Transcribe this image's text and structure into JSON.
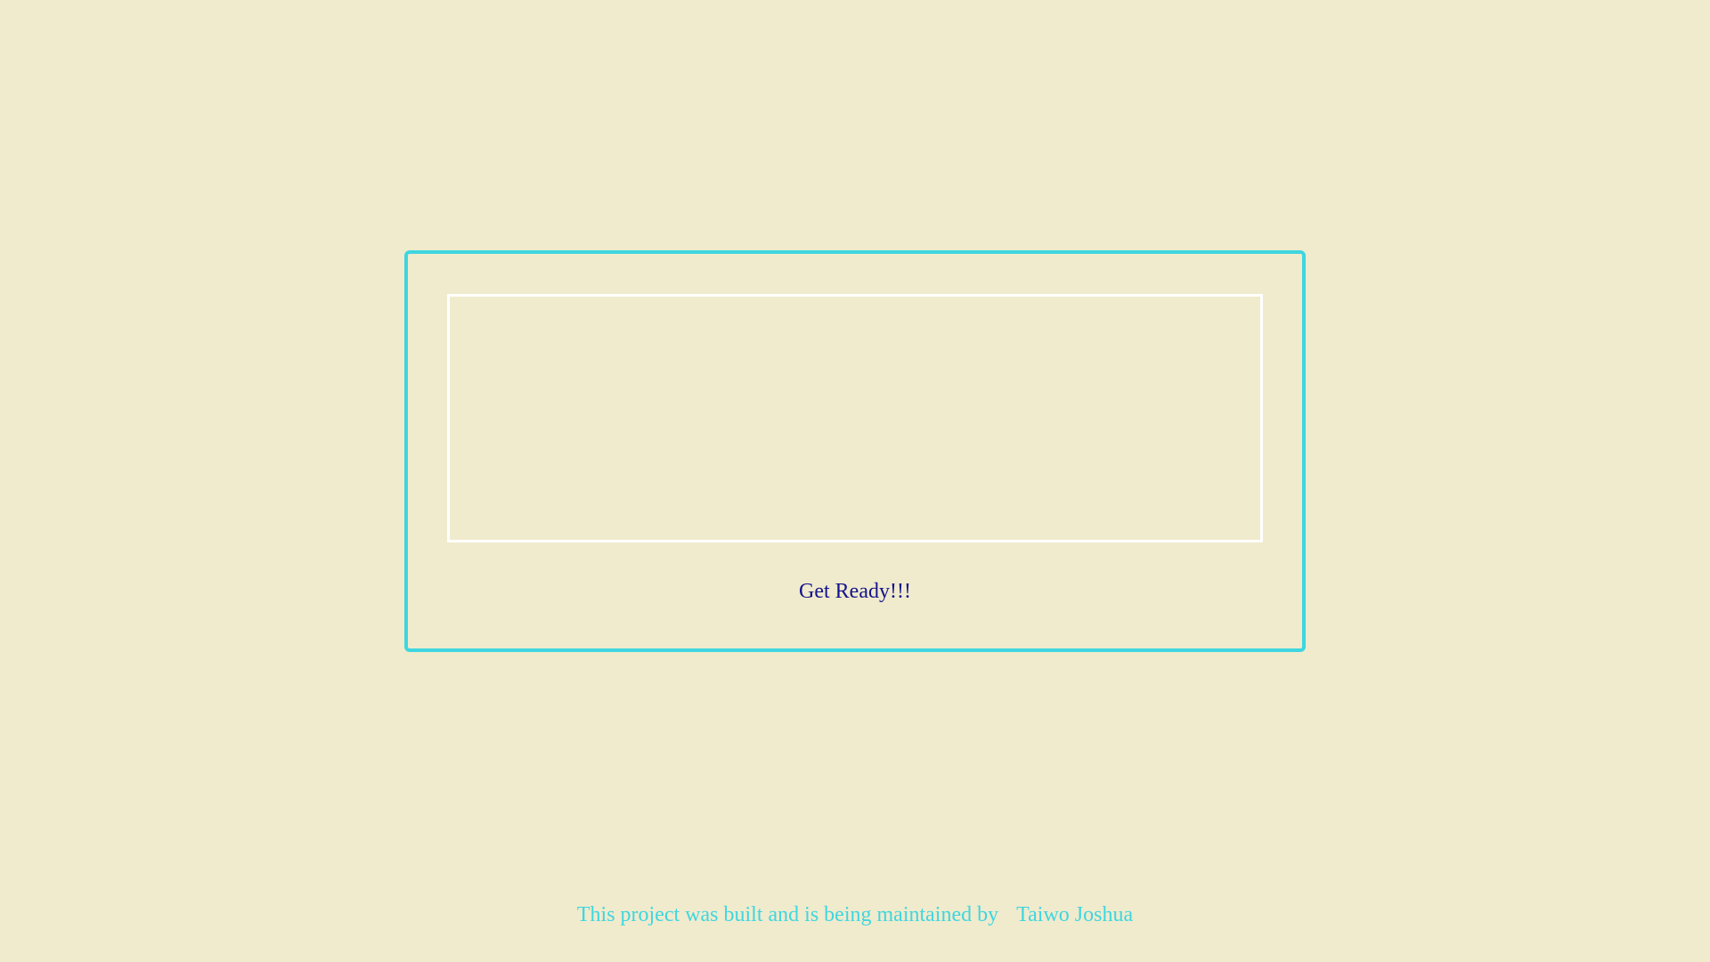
{
  "colors": {
    "background": "#f0ebcd",
    "accent": "#3ed6e0",
    "display_border": "#ffffff",
    "status_text": "#14148c"
  },
  "game": {
    "status": "Get Ready!!!"
  },
  "footer": {
    "credit_text": "This project was built and is being maintained by",
    "author_name": "Taiwo Joshua"
  }
}
